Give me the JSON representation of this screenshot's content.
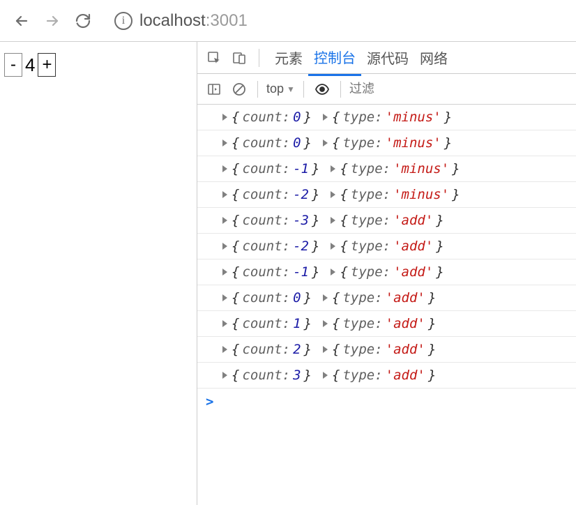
{
  "toolbar": {
    "url_host": "localhost",
    "url_port": ":3001"
  },
  "page": {
    "counter_value": "4",
    "minus_label": "-",
    "plus_label": "+"
  },
  "devtools": {
    "tabs": [
      "元素",
      "控制台",
      "源代码",
      "网络"
    ],
    "active_tab_index": 1,
    "console_toolbar": {
      "context_label": "top",
      "filter_placeholder": "过滤"
    },
    "logs": [
      {
        "count": 0,
        "type": "minus"
      },
      {
        "count": 0,
        "type": "minus"
      },
      {
        "count": -1,
        "type": "minus"
      },
      {
        "count": -2,
        "type": "minus"
      },
      {
        "count": -3,
        "type": "add"
      },
      {
        "count": -2,
        "type": "add"
      },
      {
        "count": -1,
        "type": "add"
      },
      {
        "count": 0,
        "type": "add"
      },
      {
        "count": 1,
        "type": "add"
      },
      {
        "count": 2,
        "type": "add"
      },
      {
        "count": 3,
        "type": "add"
      }
    ],
    "prompt": ">"
  }
}
